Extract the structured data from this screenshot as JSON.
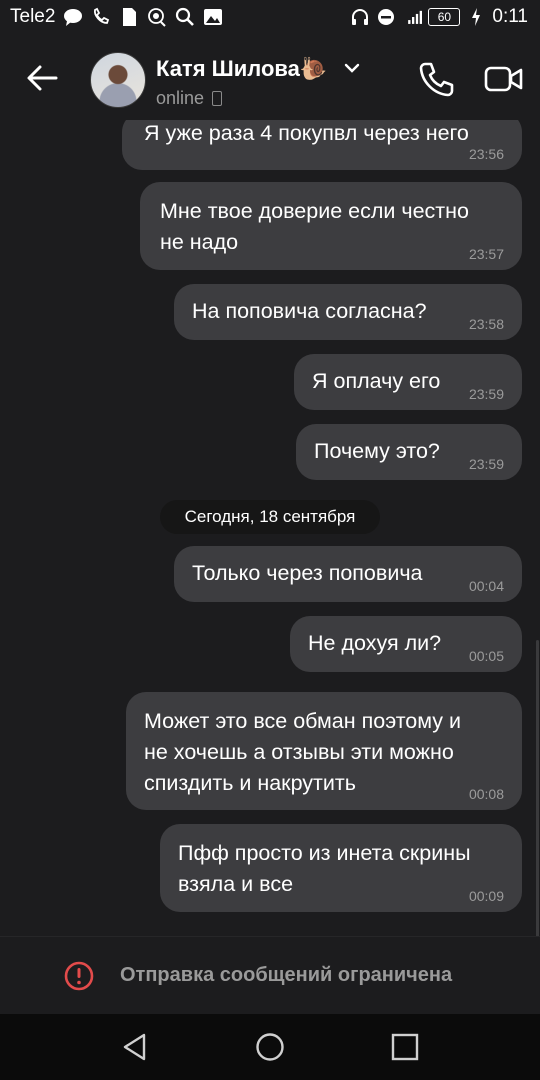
{
  "status_bar": {
    "carrier": "Tele2",
    "battery": "60",
    "time": "0:11"
  },
  "header": {
    "contact_name": "Катя Шилова🐌",
    "status": "online"
  },
  "messages": [
    {
      "text": "Я уже раза 4 покупвл через него",
      "time": "23:56"
    },
    {
      "text": "Мне твое доверие если честно\nне надо",
      "time": "23:57"
    },
    {
      "text": "На поповича согласна?",
      "time": "23:58"
    },
    {
      "text": "Я оплачу его",
      "time": "23:59"
    },
    {
      "text": "Почему это?",
      "time": "23:59"
    },
    {
      "text": "Только через поповича",
      "time": "00:04"
    },
    {
      "text": "Не дохуя ли?",
      "time": "00:05"
    },
    {
      "text": "Может это все обман поэтому и\nне хочешь а отзывы эти можно\nспиздить и накрутить",
      "time": "00:08"
    },
    {
      "text": "Пфф просто из инета скрины\nвзяла и все",
      "time": "00:09"
    }
  ],
  "date_separator": "Сегодня, 18 сентября",
  "restriction_banner": {
    "text": "Отправка сообщений ограничена",
    "icon": "alert-circle-icon",
    "color": "#e24b4b"
  },
  "colors": {
    "background": "#1c1c1e",
    "bubble": "#3d3d40",
    "time_text": "#9b9b9b"
  }
}
